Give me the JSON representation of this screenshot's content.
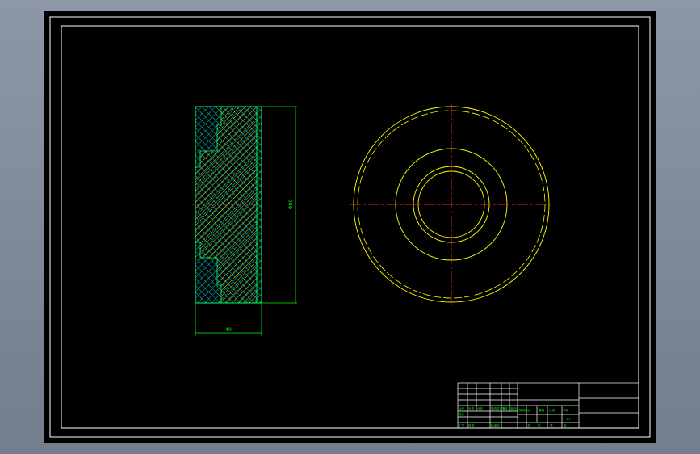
{
  "app": {
    "window": "CAD model space viewport"
  },
  "colors": {
    "background": "#000000",
    "frame": "#ffffff",
    "hatch_outer": "#00c8c8",
    "hatch_core": "#e8e800",
    "dimension": "#00ff00",
    "centerline": "#ff2020",
    "circle": "#ffff00",
    "titleblock": "#ffffff",
    "titleblock_text": "#00ff00"
  },
  "dimensions": {
    "height_label": "Φ80",
    "width_label": "40"
  },
  "title_block": {
    "cells": [
      "标记",
      "处数",
      "分区",
      "更改文件号",
      "签名",
      "年月日",
      "设计",
      "标准化",
      "阶段标记",
      "重量",
      "比例",
      "审核",
      "工艺",
      "批准",
      "共",
      "张",
      "第",
      "张",
      "1:1"
    ]
  }
}
